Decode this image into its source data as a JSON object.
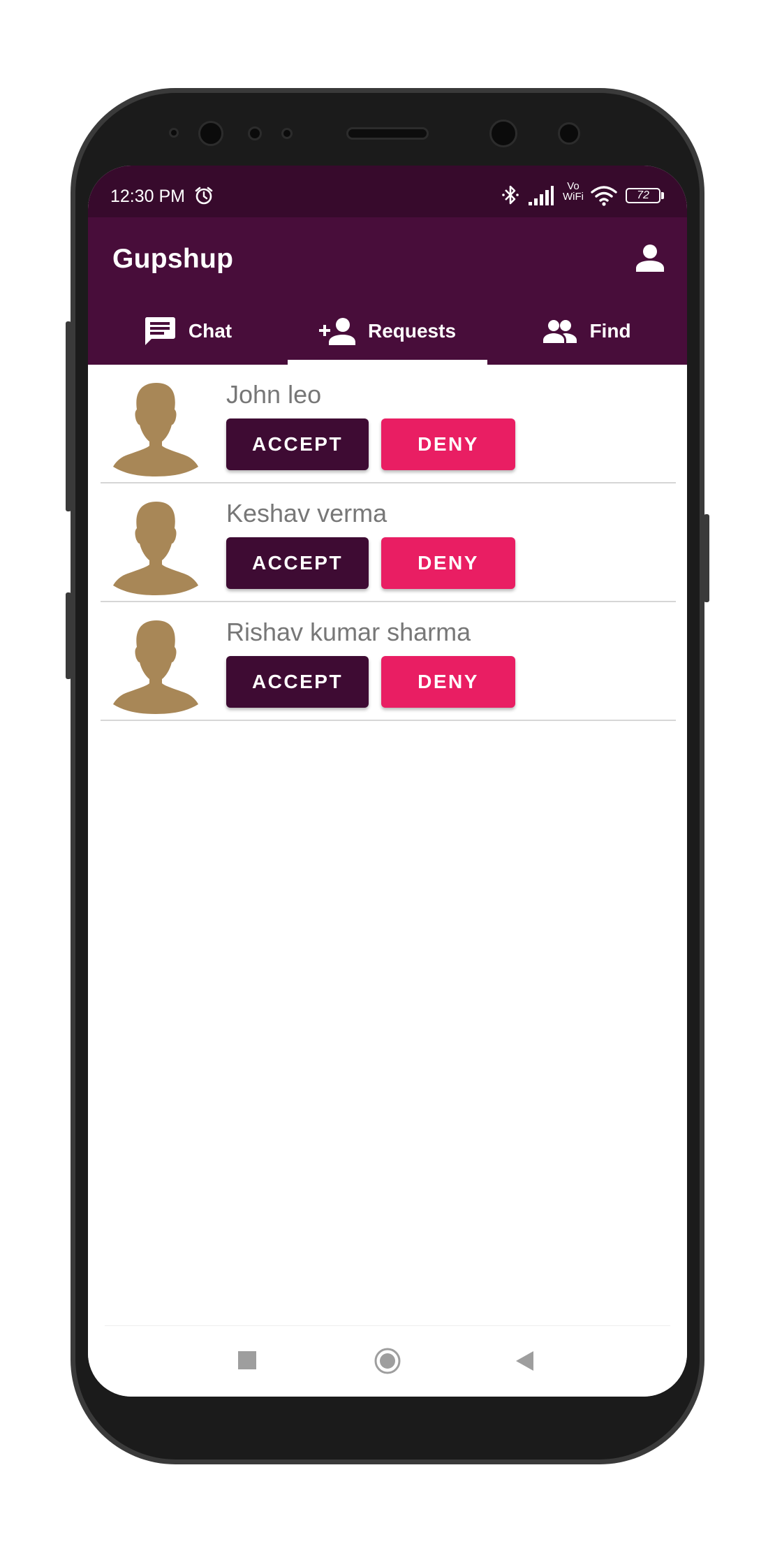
{
  "status_bar": {
    "time": "12:30 PM",
    "battery": "72",
    "network_label_top": "Vo",
    "network_label_bottom": "WiFi",
    "icons": [
      "alarm-icon",
      "bluetooth-icon",
      "signal-icon",
      "wifi-icon",
      "battery-icon"
    ]
  },
  "app_bar": {
    "title": "Gupshup",
    "profile_icon": "person-icon"
  },
  "tabs": [
    {
      "label": "Chat",
      "icon": "chat-icon",
      "selected": false
    },
    {
      "label": "Requests",
      "icon": "person-add-icon",
      "selected": true
    },
    {
      "label": "Find",
      "icon": "people-icon",
      "selected": false
    }
  ],
  "requests": [
    {
      "name": "John leo",
      "accept_label": "ACCEPT",
      "deny_label": "DENY"
    },
    {
      "name": "Keshav verma",
      "accept_label": "ACCEPT",
      "deny_label": "DENY"
    },
    {
      "name": "Rishav kumar sharma",
      "accept_label": "ACCEPT",
      "deny_label": "DENY"
    }
  ],
  "nav_bar": {
    "icons": [
      "recents-square-icon",
      "home-circle-icon",
      "back-triangle-icon"
    ]
  },
  "colors": {
    "status_bar": "#370a2c",
    "app_bar": "#480d3a",
    "accept_button": "#3e0b33",
    "deny_button": "#e91e63",
    "avatar": "#a88757",
    "name_text": "#777777"
  }
}
